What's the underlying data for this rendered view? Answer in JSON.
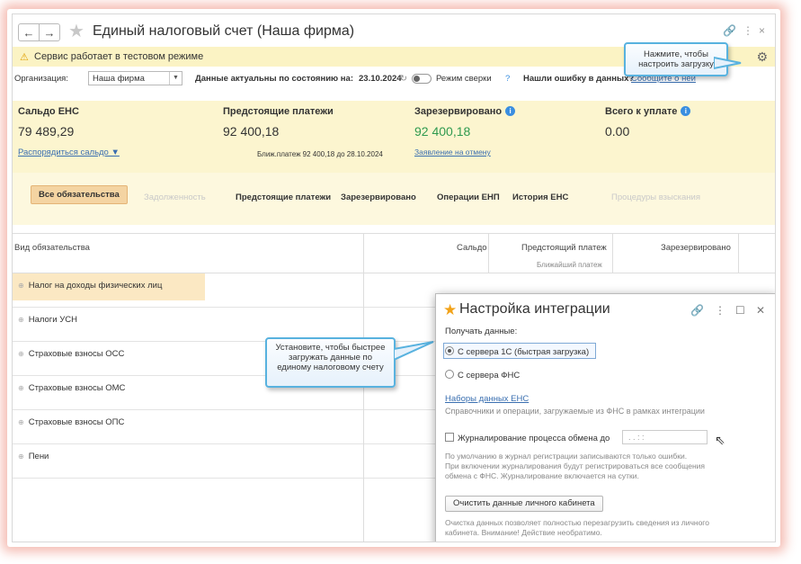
{
  "window": {
    "title": "Единый налоговый счет (Наша фирма)",
    "back_glyph": "←",
    "forward_glyph": "→",
    "icons": [
      "star-icon",
      "link-icon",
      "more-icon",
      "close-icon"
    ]
  },
  "warning": {
    "text": "Сервис работает в тестовом режиме"
  },
  "org_row": {
    "org_label": "Организация:",
    "org_value": "Наша фирма",
    "data_actual_label": "Данные актуальны по состоянию на:",
    "date": "23.10.2024",
    "mode_label": "Режим сверки",
    "mode_help": "?",
    "error_text": "Нашли ошибку в данных?",
    "error_link": "Сообщите о ней"
  },
  "summary": {
    "balance_title": "Сальдо ЕНС",
    "balance_value": "79 489,29",
    "balance_link": "Распорядиться сальдо ▼",
    "upcoming_title": "Предстоящие платежи",
    "upcoming_value": "92 400,18",
    "upcoming_note": "Ближ.платеж 92 400,18 до 28.10.2024",
    "reserved_title": "Зарезервировано",
    "reserved_value": "92 400,18",
    "reserved_link": "Заявление на отмену",
    "total_title": "Всего к уплате",
    "total_value": "0.00"
  },
  "tabs": [
    {
      "label": "Все обязательства",
      "state": "active"
    },
    {
      "label": "Задолженность",
      "state": "disabled"
    },
    {
      "label": "Предстоящие платежи",
      "state": "normal"
    },
    {
      "label": "Зарезервировано",
      "state": "normal"
    },
    {
      "label": "Операции ЕНП",
      "state": "normal"
    },
    {
      "label": "История ЕНС",
      "state": "normal"
    },
    {
      "label": "Процедуры взыскания",
      "state": "disabled"
    }
  ],
  "table": {
    "headers": {
      "type": "Вид обязательства",
      "balance": "Сальдо",
      "upcoming": "Предстоящий платеж",
      "upcoming_sub": "Ближайший платеж",
      "reserved": "Зарезервировано"
    },
    "rows": [
      "Налог на доходы физических лиц",
      "Налоги УСН",
      "Страховые взносы ОСС",
      "Страховые взносы ОМС",
      "Страховые взносы ОПС",
      "Пени"
    ]
  },
  "callouts": {
    "gear_hint": "Нажмите, чтобы настроить загрузку",
    "server_hint": "Установите, чтобы быстрее загружать данные по единому налоговому счету"
  },
  "dialog": {
    "title": "Настройка интеграции",
    "receive_label": "Получать данные:",
    "option_1c": "С сервера 1С (быстрая загрузка)",
    "option_fns": "С сервера ФНС",
    "datasets_link": "Наборы данных ЕНС",
    "datasets_desc": "Справочники и операции, загружаемые из ФНС в рамках интеграции",
    "logging_label": "Журналирование процесса обмена до",
    "logging_value": ".  .     :  :",
    "logging_hint_1": "По умолчанию в журнал регистрации записываются только ошибки.",
    "logging_hint_2": "При включении журналирования будут регистрироваться все сообщения",
    "logging_hint_3": "обмена с ФНС. Журналирование включается на сутки.",
    "clear_button": "Очистить данные личного кабинета",
    "clear_hint_1": "Очистка данных позволяет полностью перезагрузить сведения из личного",
    "clear_hint_2": "кабинета. Внимание! Действие необратимо."
  }
}
